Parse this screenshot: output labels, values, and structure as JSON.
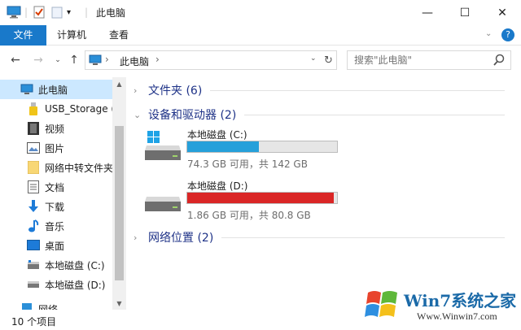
{
  "window": {
    "title": "此电脑",
    "controls": {
      "minimize": "—",
      "maximize": "☐",
      "close": "✕"
    }
  },
  "ribbon": {
    "tabs": [
      {
        "label": "文件"
      },
      {
        "label": "计算机"
      },
      {
        "label": "查看"
      }
    ],
    "help": "?"
  },
  "address": {
    "crumb": "此电脑",
    "crumb_sep": "›",
    "search_placeholder": "搜索\"此电脑\""
  },
  "nav": {
    "items": [
      {
        "label": "此电脑",
        "icon": "computer-icon",
        "selected": true
      },
      {
        "label": "USB_Storage (F",
        "icon": "usb-drive-icon"
      },
      {
        "label": "视频",
        "icon": "video-icon"
      },
      {
        "label": "图片",
        "icon": "pictures-icon"
      },
      {
        "label": "网络中转文件夹",
        "icon": "folder-icon"
      },
      {
        "label": "文档",
        "icon": "documents-icon"
      },
      {
        "label": "下载",
        "icon": "download-icon"
      },
      {
        "label": "音乐",
        "icon": "music-icon"
      },
      {
        "label": "桌面",
        "icon": "desktop-icon"
      },
      {
        "label": "本地磁盘 (C:)",
        "icon": "drive-icon"
      },
      {
        "label": "本地磁盘 (D:)",
        "icon": "drive-icon"
      },
      {
        "label": "网络",
        "icon": "network-icon"
      }
    ]
  },
  "content": {
    "groups": [
      {
        "title": "文件夹 (6)",
        "expanded": false
      },
      {
        "title": "设备和驱动器 (2)",
        "expanded": true
      },
      {
        "title": "网络位置 (2)",
        "expanded": false
      }
    ],
    "drives": [
      {
        "name": "本地磁盘 (C:)",
        "free_text": "74.3 GB 可用，共 142 GB",
        "used_fraction": 0.477,
        "bar_color": "#26a0da",
        "icon": "windows-drive-icon"
      },
      {
        "name": "本地磁盘 (D:)",
        "free_text": "1.86 GB 可用，共 80.8 GB",
        "used_fraction": 0.977,
        "bar_color": "#da2626",
        "icon": "drive-icon"
      }
    ]
  },
  "status": {
    "item_count": "10 个项目"
  },
  "watermark": {
    "brand": "Win7系统之家",
    "url": "Www.Winwin7.com"
  }
}
